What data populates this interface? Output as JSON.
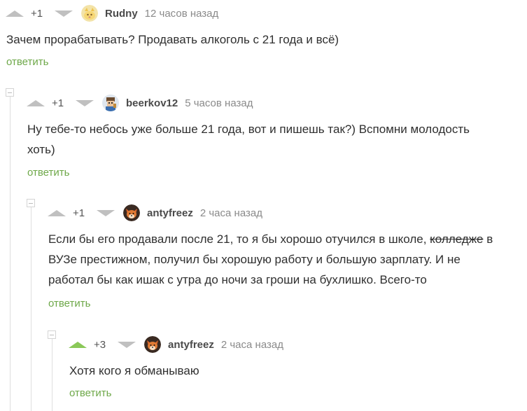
{
  "comments": [
    {
      "rating": "+1",
      "author": "Rudny",
      "time": "12 часов назад",
      "text": "Зачем прорабатывать? Продавать алкоголь с 21 года и всё)",
      "reply": "ответить",
      "avatar": "cat-avatar"
    },
    {
      "rating": "+1",
      "author": "beerkov12",
      "time": "5 часов назад",
      "text_lines": [
        "Ну тебе-то небось уже больше 21 года, вот и пишешь так?) Вспомни молодость",
        "хоть)"
      ],
      "reply": "ответить",
      "avatar": "pixel-avatar"
    },
    {
      "rating": "+1",
      "author": "antyfreez",
      "time": "2 часа назад",
      "text_line1_before": "Если бы его продавали после 21, то я бы хорошо отучился в школе, ",
      "text_line1_strike": "колледже",
      "text_line1_after": " в",
      "text_lines_rest": [
        "ВУЗе престижном, получил бы хорошую работу и большую зарплату. И не",
        "работал бы как ишак с утра до ночи за гроши на бухлишко. Всего-то"
      ],
      "reply": "ответить",
      "avatar": "fox-avatar"
    },
    {
      "rating": "+3",
      "author": "antyfreez",
      "time": "2 часа назад",
      "text": "Хотя кого я обманываю",
      "reply": "ответить",
      "avatar": "fox-avatar"
    }
  ],
  "colors": {
    "accent_green": "#8ac858",
    "reply_green": "#6ea849",
    "muted": "#8a8a8a"
  }
}
